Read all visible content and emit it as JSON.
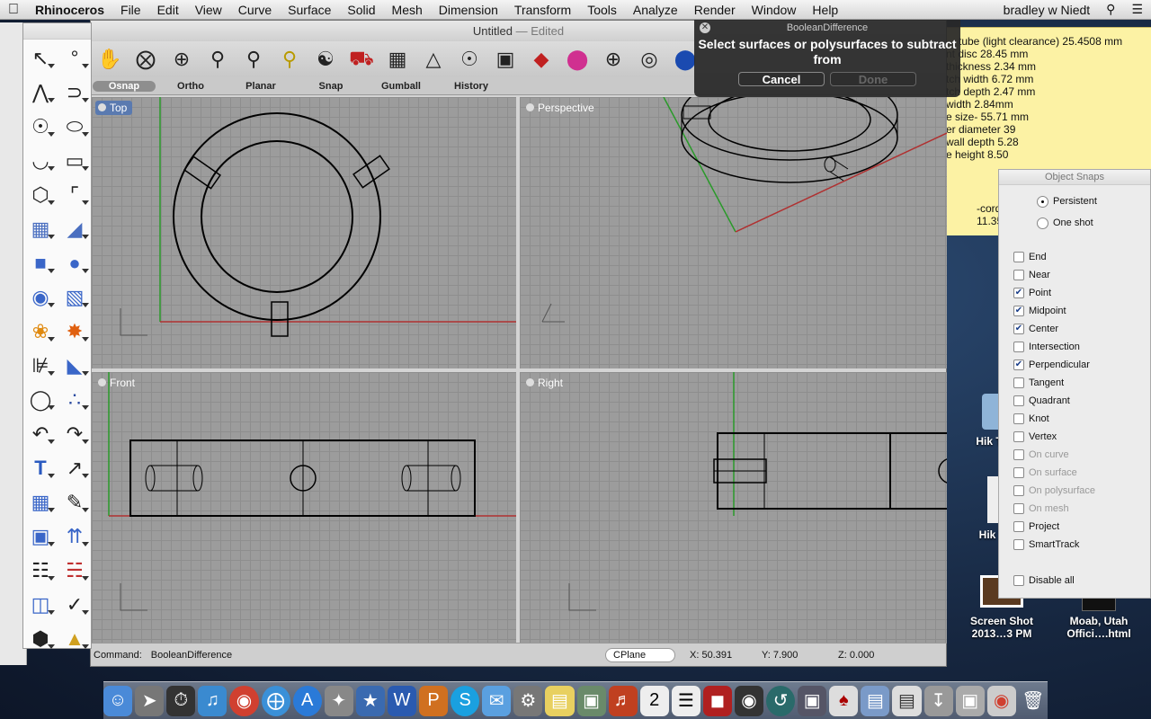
{
  "menubar": {
    "apple": "",
    "app": "Rhinoceros",
    "items": [
      "File",
      "Edit",
      "View",
      "Curve",
      "Surface",
      "Solid",
      "Mesh",
      "Dimension",
      "Transform",
      "Tools",
      "Analyze",
      "Render",
      "Window",
      "Help"
    ],
    "user": "bradley w Niedt",
    "search_icon": "search-icon",
    "list_icon": "list-icon"
  },
  "window": {
    "title": "Untitled",
    "edited": " — Edited"
  },
  "osnap_bar": [
    "Osnap",
    "Ortho",
    "Planar",
    "Snap",
    "Gumball",
    "History"
  ],
  "viewports": {
    "top": "Top",
    "perspective": "Perspective",
    "front": "Front",
    "right": "Right"
  },
  "status": {
    "command_label": "Command:",
    "command": "BooleanDifference",
    "cplane": "CPlane",
    "x": "X: 50.391",
    "y": "Y: 7.900",
    "z": "Z: 0.000"
  },
  "dialog": {
    "title": "BooleanDifference",
    "message": "Select surfaces or polysurfaces to subtract from",
    "cancel": "Cancel",
    "done": "Done"
  },
  "note": {
    "lines": [
      "tube (light clearance) 25.4508 mm",
      "nt disc 28.45 mm",
      "thickness 2.34 mm",
      "tch width 6.72 mm",
      "tch depth 2.47 mm",
      "width 2.84mm",
      "e size- 55.71 mm",
      "er diameter 39",
      "wall depth 5.28",
      "e height 8.50"
    ],
    "lower": [
      "-cord",
      "11.35"
    ]
  },
  "object_snaps": {
    "title": "Object Snaps",
    "modes": [
      {
        "label": "Persistent",
        "selected": true
      },
      {
        "label": "One shot",
        "selected": false
      }
    ],
    "items": [
      {
        "label": "End",
        "checked": false,
        "enabled": true
      },
      {
        "label": "Near",
        "checked": false,
        "enabled": true
      },
      {
        "label": "Point",
        "checked": true,
        "enabled": true
      },
      {
        "label": "Midpoint",
        "checked": true,
        "enabled": true
      },
      {
        "label": "Center",
        "checked": true,
        "enabled": true
      },
      {
        "label": "Intersection",
        "checked": false,
        "enabled": true
      },
      {
        "label": "Perpendicular",
        "checked": true,
        "enabled": true
      },
      {
        "label": "Tangent",
        "checked": false,
        "enabled": true
      },
      {
        "label": "Quadrant",
        "checked": false,
        "enabled": true
      },
      {
        "label": "Knot",
        "checked": false,
        "enabled": true
      },
      {
        "label": "Vertex",
        "checked": false,
        "enabled": true
      },
      {
        "label": "On curve",
        "checked": false,
        "enabled": false
      },
      {
        "label": "On surface",
        "checked": false,
        "enabled": false
      },
      {
        "label": "On polysurface",
        "checked": false,
        "enabled": false
      },
      {
        "label": "On mesh",
        "checked": false,
        "enabled": false
      },
      {
        "label": "Project",
        "checked": false,
        "enabled": true
      },
      {
        "label": "SmartTrack",
        "checked": false,
        "enabled": true
      }
    ],
    "disable_all": "Disable all"
  },
  "desktop": [
    {
      "label": "Hik Trails",
      "icon": "folder-icon"
    },
    {
      "label": "Hik Trail",
      "icon": "document-icon"
    },
    {
      "label": "Screen Shot 2013…3 PM",
      "icon": "image-icon"
    },
    {
      "label": "Moab, Utah Offici….html",
      "icon": "html-file-icon"
    }
  ],
  "colors": {
    "active_viewport": "#5a7ab0",
    "x_axis": "#b03030",
    "y_axis": "#2a9a2a",
    "note": "#fcf2a4"
  }
}
